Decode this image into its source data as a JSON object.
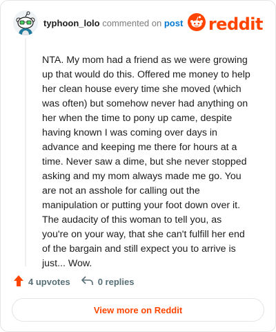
{
  "header": {
    "username": "typhoon_lolo",
    "verb": "commented on",
    "post_link": "post",
    "brand_wordmark": "reddit"
  },
  "comment": {
    "body": "NTA. My mom had a friend as we were growing up that would do this. Offered me money to help her clean house every time she moved (which was often) but somehow never had anything on her when the time to pony up came, despite having known I was coming over days in advance and keeping me there for hours at a time. Never saw a dime, but she never stopped asking and my mom always made me go. You are not an asshole for calling out the manipulation or putting your foot down over it. The audacity of this woman to tell you, as you're on your way, that she can't fulfill her end of the bargain and still expect you to arrive is just... Wow."
  },
  "actions": {
    "upvotes": "4 upvotes",
    "replies": "0 replies"
  },
  "footer": {
    "view_more_label": "View more on Reddit"
  },
  "colors": {
    "brand": "#ff4500",
    "link": "#0079d3"
  },
  "icons": {
    "avatar": "snoo-avatar-icon",
    "logo": "reddit-snoo-icon",
    "upvote": "upvote-arrow-icon",
    "reply": "reply-arrow-icon"
  }
}
